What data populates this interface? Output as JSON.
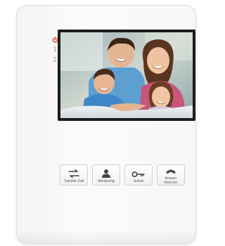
{
  "indicators": {
    "power_icon": "power-icon",
    "item1": "1",
    "item2": "2"
  },
  "screen": {
    "image": "family-photo"
  },
  "buttons": [
    {
      "icon": "transfer-icon",
      "label": "Transfer Call"
    },
    {
      "icon": "person-icon",
      "label": "Monitoring"
    },
    {
      "icon": "key-icon",
      "label": "Unlock"
    },
    {
      "icon": "phone-handset-icon",
      "label": "Answer\nIntercom"
    }
  ],
  "colors": {
    "power": "#e53935",
    "bezel": "#1c1c1c",
    "body": "#f6f6f6"
  }
}
